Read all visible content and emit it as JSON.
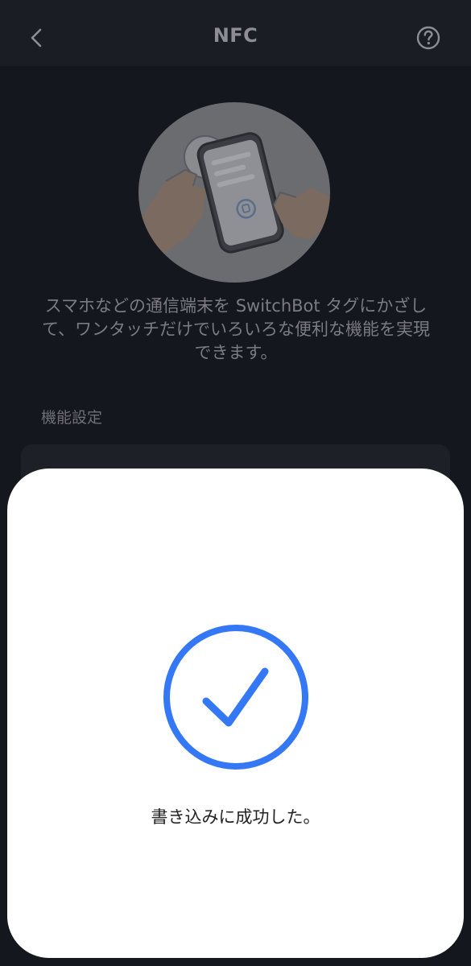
{
  "header": {
    "title": "NFC",
    "back_icon": "chevron-left-icon",
    "help_icon": "question-circle-icon"
  },
  "main": {
    "illustration": "phone-tap-nfc-illustration",
    "description": "スマホなどの通信端末を SwitchBot タグにかざして、ワンタッチだけでいろいろな便利な機能を実現できます。",
    "section_label": "機能設定"
  },
  "modal": {
    "icon": "check-circle-icon",
    "message": "書き込みに成功した。",
    "accent_color": "#3478f6"
  }
}
